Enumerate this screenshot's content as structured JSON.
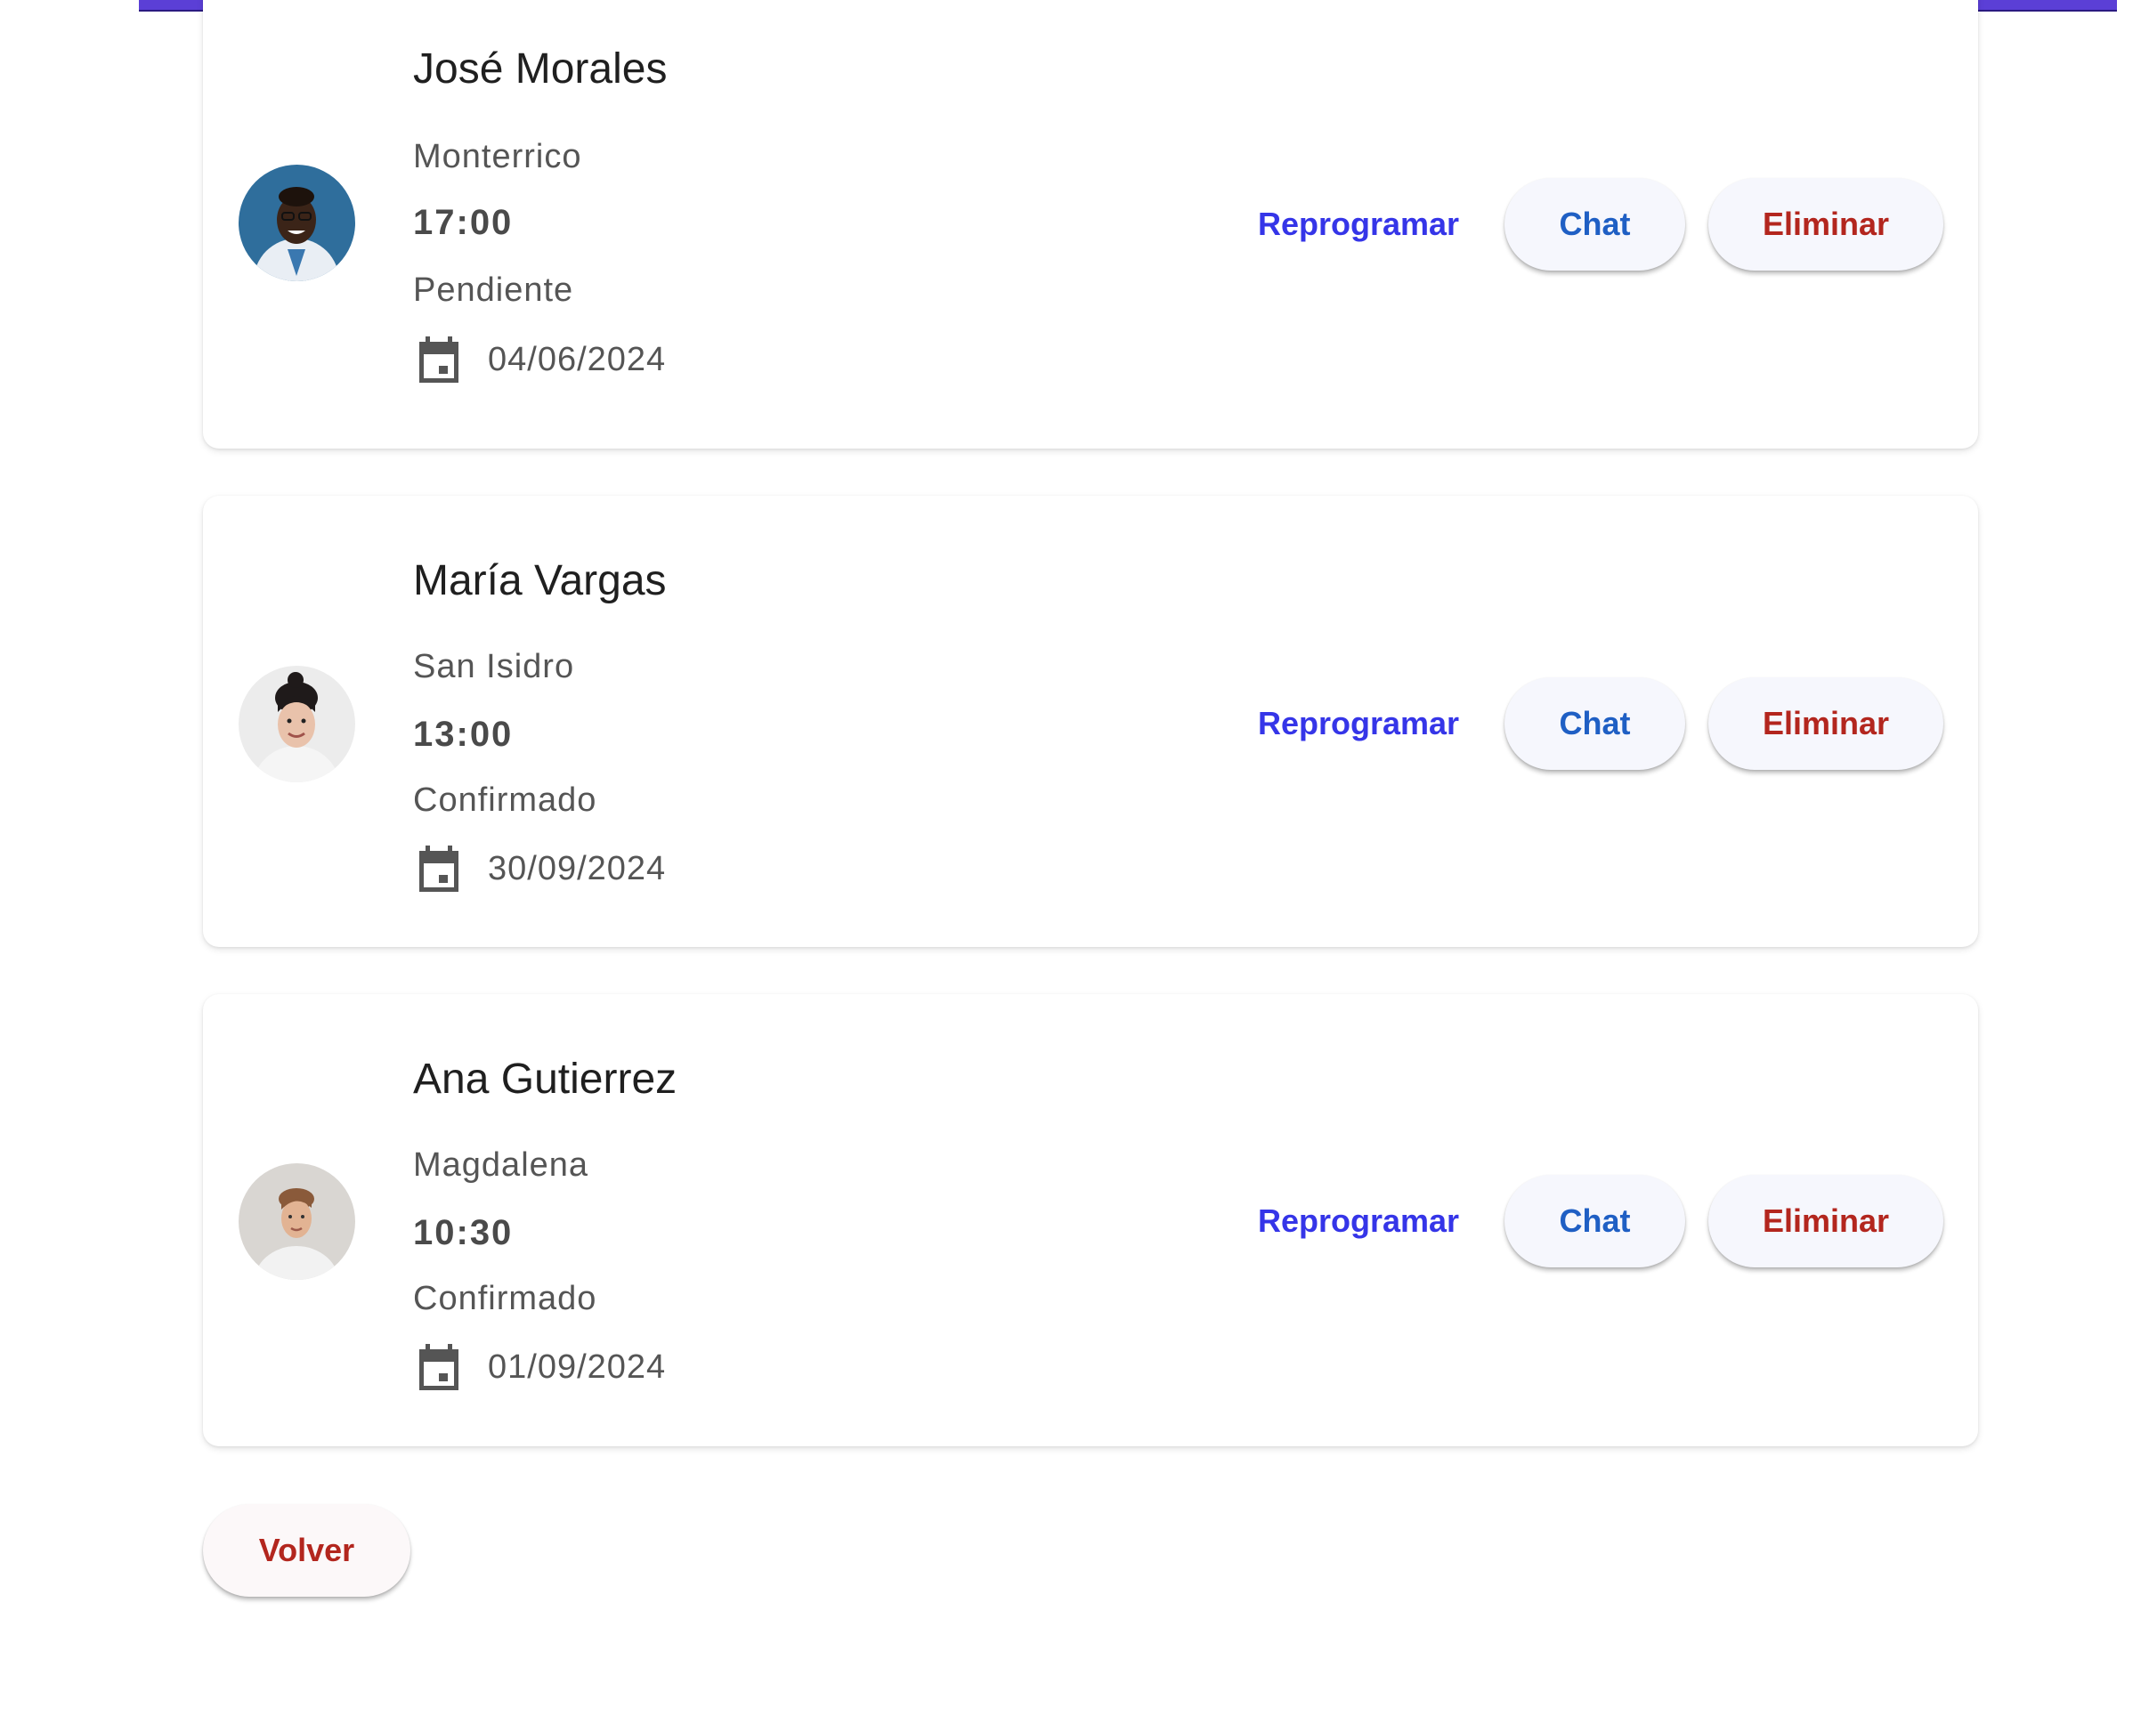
{
  "appointments": [
    {
      "name": "José Morales",
      "location": "Monterrico",
      "time": "17:00",
      "status": "Pendiente",
      "date": "04/06/2024"
    },
    {
      "name": "María Vargas",
      "location": "San Isidro",
      "time": "13:00",
      "status": "Confirmado",
      "date": "30/09/2024"
    },
    {
      "name": "Ana Gutierrez",
      "location": "Magdalena",
      "time": "10:30",
      "status": "Confirmado",
      "date": "01/09/2024"
    }
  ],
  "actions": {
    "reschedule_label": "Reprogramar",
    "chat_label": "Chat",
    "delete_label": "Eliminar"
  },
  "footer": {
    "back_label": "Volver"
  },
  "icons": {
    "date": "calendar-icon"
  },
  "colors": {
    "accent_bar": "#5b3fd6",
    "reschedule": "#3535e8",
    "chat": "#1f5fc4",
    "delete": "#b3261e"
  }
}
